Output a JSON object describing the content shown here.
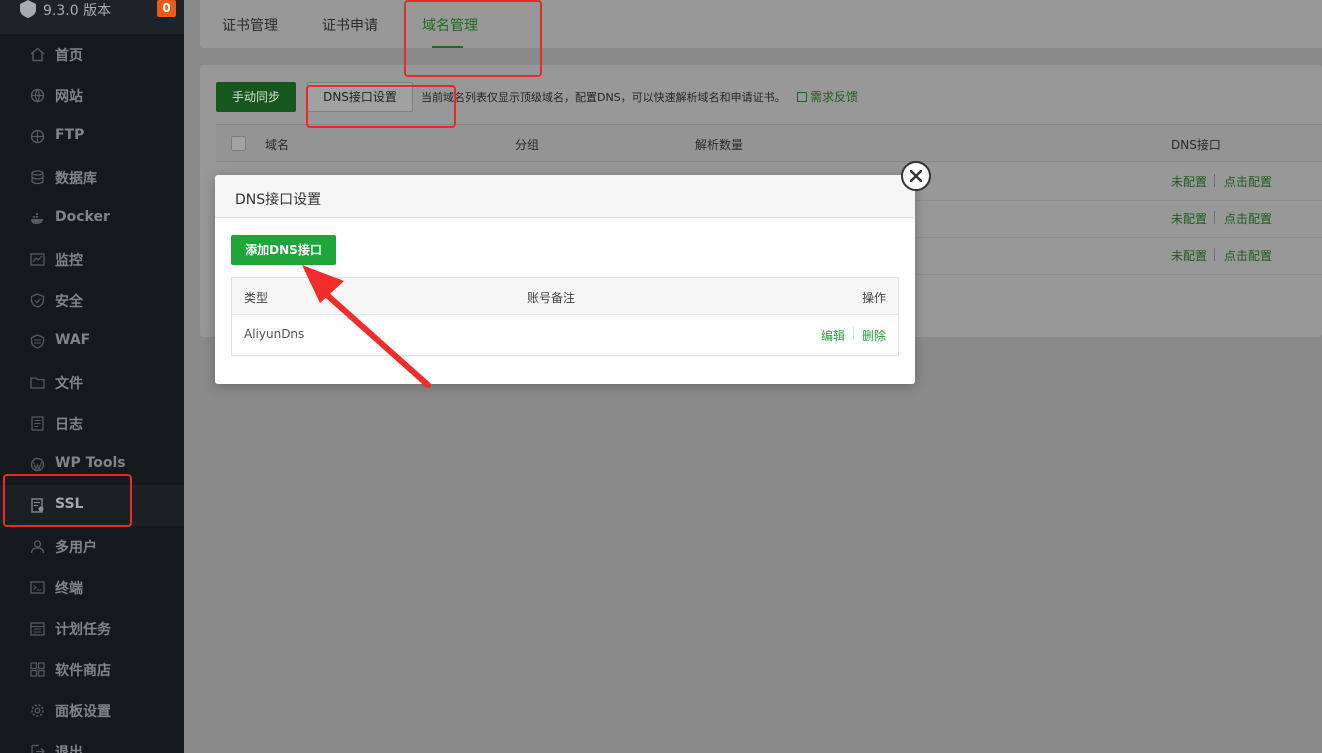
{
  "sidebar": {
    "version": "9.3.0 版本",
    "badge": "0",
    "items": [
      {
        "label": "首页",
        "icon": "home-icon"
      },
      {
        "label": "网站",
        "icon": "globe-icon"
      },
      {
        "label": "FTP",
        "icon": "ftp-icon"
      },
      {
        "label": "数据库",
        "icon": "database-icon"
      },
      {
        "label": "Docker",
        "icon": "docker-icon"
      },
      {
        "label": "监控",
        "icon": "monitor-icon"
      },
      {
        "label": "安全",
        "icon": "shield-icon"
      },
      {
        "label": "WAF",
        "icon": "waf-icon"
      },
      {
        "label": "文件",
        "icon": "folder-icon"
      },
      {
        "label": "日志",
        "icon": "log-icon"
      },
      {
        "label": "WP Tools",
        "icon": "wordpress-icon"
      },
      {
        "label": "SSL",
        "icon": "ssl-icon"
      },
      {
        "label": "多用户",
        "icon": "users-icon"
      },
      {
        "label": "终端",
        "icon": "terminal-icon"
      },
      {
        "label": "计划任务",
        "icon": "calendar-icon"
      },
      {
        "label": "软件商店",
        "icon": "grid-icon"
      },
      {
        "label": "面板设置",
        "icon": "gear-icon"
      },
      {
        "label": "退出",
        "icon": "logout-icon"
      }
    ]
  },
  "tabs": [
    "证书管理",
    "证书申请",
    "域名管理"
  ],
  "toolbar": {
    "sync_label": "手动同步",
    "dns_settings_label": "DNS接口设置",
    "tip": "当前域名列表仅显示顶级域名，配置DNS，可以快速解析域名和申请证书。",
    "feedback": "需求反馈"
  },
  "domain_table": {
    "headers": [
      "域名",
      "分组",
      "解析数量",
      "DNS接口"
    ],
    "rows": [
      {
        "status": "未配置",
        "action": "点击配置"
      },
      {
        "status": "未配置",
        "action": "点击配置"
      },
      {
        "status": "未配置",
        "action": "点击配置"
      }
    ]
  },
  "dialog": {
    "title": "DNS接口设置",
    "add_label": "添加DNS接口",
    "headers": [
      "类型",
      "账号备注",
      "操作"
    ],
    "rows": [
      {
        "type": "AliyunDns",
        "remark": "",
        "edit": "编辑",
        "delete": "删除"
      }
    ]
  },
  "colors": {
    "accent": "#20a53a",
    "highlight": "#e72b2b",
    "badge": "#ea5b1b"
  }
}
